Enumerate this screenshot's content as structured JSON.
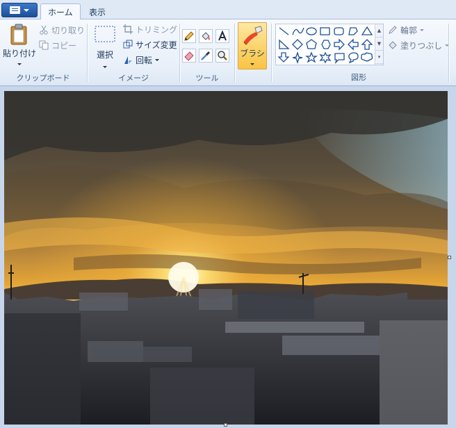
{
  "tabs": [
    {
      "label": "ホーム",
      "active": true
    },
    {
      "label": "表示",
      "active": false
    }
  ],
  "clipboard": {
    "paste_label": "貼り付け",
    "cut_label": "切り取り",
    "copy_label": "コピー",
    "group_label": "クリップボード"
  },
  "image": {
    "select_label": "選択",
    "crop_label": "トリミング",
    "resize_label": "サイズ変更",
    "rotate_label": "回転",
    "group_label": "イメージ"
  },
  "tools": {
    "group_label": "ツール",
    "items": [
      "pencil-icon",
      "fill-icon",
      "text-icon",
      "eraser-icon",
      "color-picker-icon",
      "magnifier-icon"
    ]
  },
  "brushes": {
    "label": "ブラシ"
  },
  "shapes": {
    "outline_label": "輪郭",
    "fill_label": "塗りつぶし",
    "group_label": "図形"
  },
  "colors": {
    "ribbon_text": "#1e395b",
    "accent": "#1b4f9a",
    "brush_active": "#fbd36a"
  }
}
